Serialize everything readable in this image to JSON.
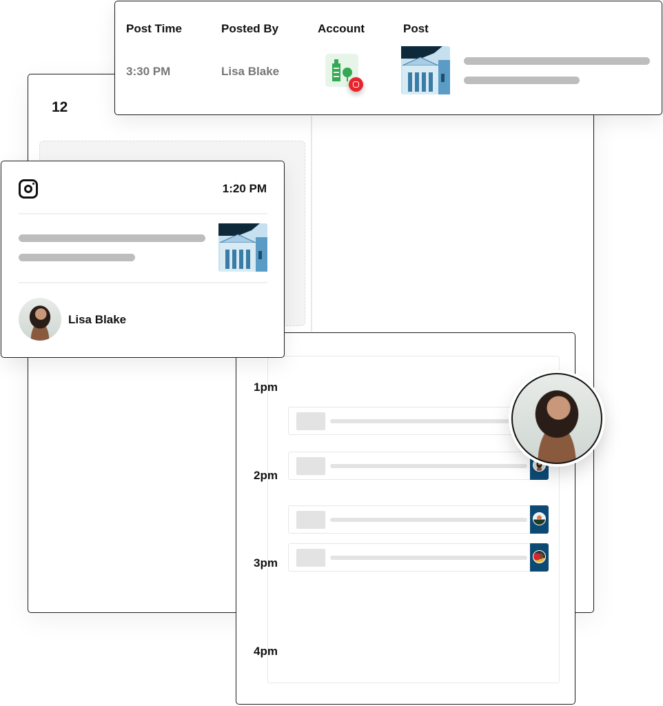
{
  "calendar": {
    "day": "12"
  },
  "table": {
    "headers": [
      "Post Time",
      "Posted By",
      "Account",
      "Post"
    ],
    "row": {
      "post_time": "3:30 PM",
      "posted_by": "Lisa Blake",
      "account_icon": "building-tree-icon",
      "account_badge": "instagram-icon"
    }
  },
  "post_card": {
    "network_icon": "instagram-icon",
    "time": "1:20 PM",
    "author": "Lisa Blake"
  },
  "schedule": {
    "times": [
      "1pm",
      "2pm",
      "3pm",
      "4pm"
    ]
  },
  "colors": {
    "accent_blue": "#0d4a73",
    "instagram_badge": "#e8232b",
    "account_green": "#34a853"
  }
}
